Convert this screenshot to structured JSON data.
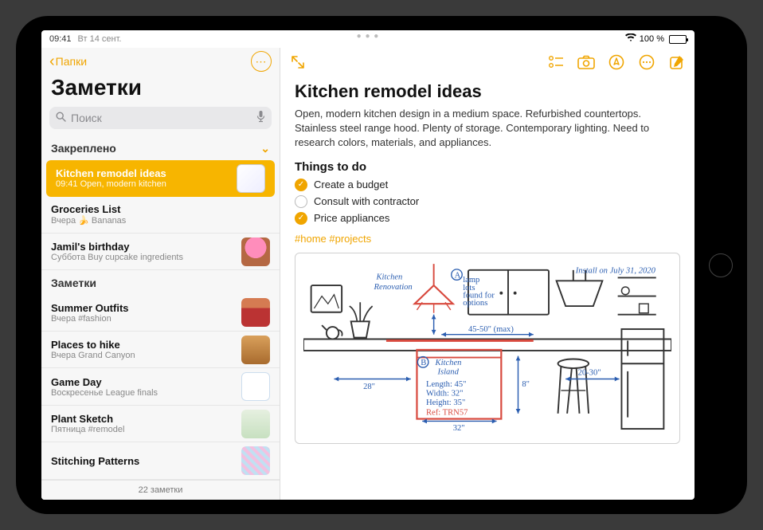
{
  "status": {
    "time": "09:41",
    "date": "Вт 14 сент.",
    "battery": "100 %",
    "wifi": "wifi"
  },
  "sidebar": {
    "back": "Папки",
    "title": "Заметки",
    "search_placeholder": "Поиск",
    "pinned_header": "Закреплено",
    "notes_header": "Заметки",
    "footer": "22 заметки",
    "pinned": [
      {
        "title": "Kitchen remodel ideas",
        "time": "09:41",
        "preview": "Open, modern kitchen"
      },
      {
        "title": "Groceries List",
        "time": "Вчера",
        "preview": "🍌 Bananas"
      },
      {
        "title": "Jamil's birthday",
        "time": "Суббота",
        "preview": "Buy cupcake ingredients"
      }
    ],
    "notes": [
      {
        "title": "Summer Outfits",
        "time": "Вчера",
        "preview": "#fashion"
      },
      {
        "title": "Places to hike",
        "time": "Вчера",
        "preview": "Grand Canyon"
      },
      {
        "title": "Game Day",
        "time": "Воскресенье",
        "preview": "League finals"
      },
      {
        "title": "Plant Sketch",
        "time": "Пятница",
        "preview": "#remodel"
      },
      {
        "title": "Stitching Patterns",
        "time": "",
        "preview": ""
      }
    ]
  },
  "note": {
    "title": "Kitchen remodel ideas",
    "description": "Open, modern kitchen design in a medium space. Refurbished countertops. Stainless steel range hood. Plenty of storage. Contemporary lighting. Need to research colors, materials, and appliances.",
    "todo_header": "Things to do",
    "todos": [
      {
        "text": "Create a budget",
        "checked": true
      },
      {
        "text": "Consult with contractor",
        "checked": false
      },
      {
        "text": "Price appliances",
        "checked": true
      }
    ],
    "tags": "#home #projects",
    "sketch": {
      "title_a": "Kitchen",
      "title_b": "Renovation",
      "install": "Install on July 31, 2020",
      "mark_a": "A",
      "lamp_note_a": "lamp",
      "lamp_note_b": "lots",
      "lamp_note_c": "found for",
      "lamp_note_d": "options",
      "mark_b": "B",
      "island_a": "Kitchen",
      "island_b": "Island",
      "length": "Length: 45\"",
      "width": "Width: 32\"",
      "height": "Height: 35\"",
      "ref": "Ref: TRN57",
      "dim_28": "28\"",
      "dim_32": "32\"",
      "dim_45": "45-50\" (max)",
      "dim_20": "20-30\""
    }
  }
}
